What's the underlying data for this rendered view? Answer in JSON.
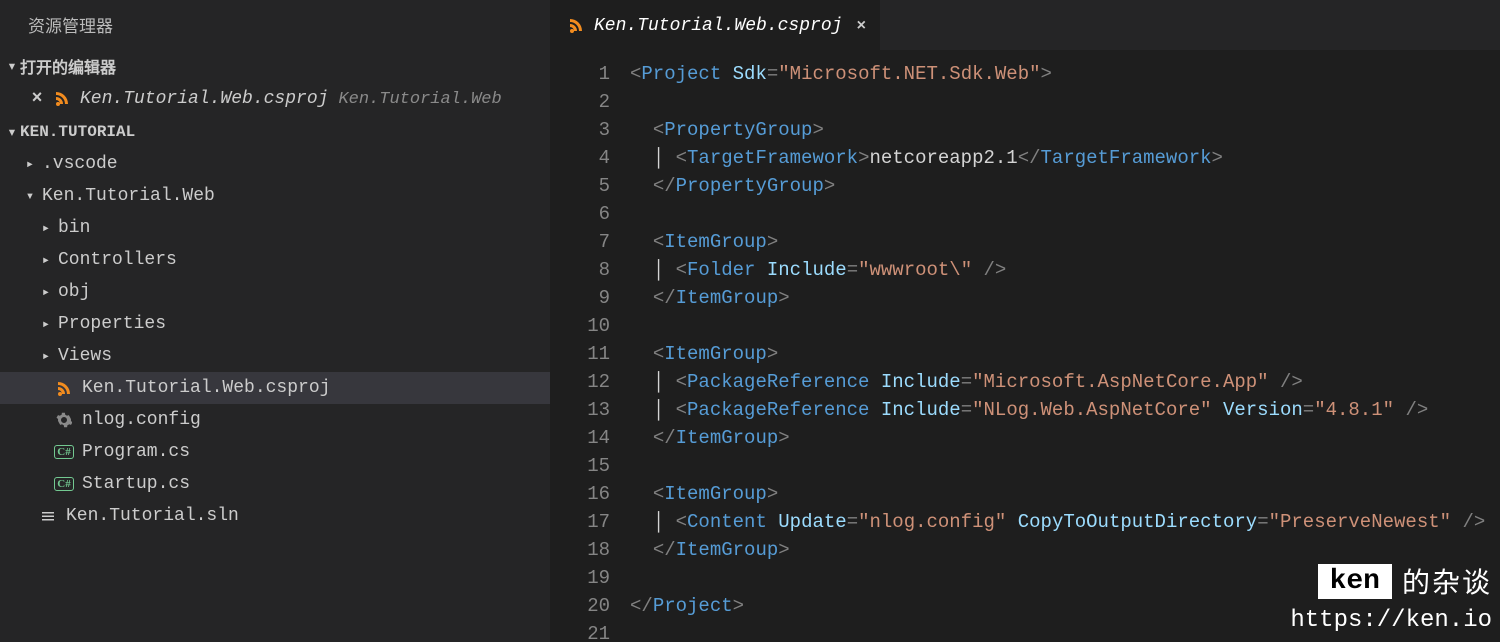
{
  "sidebar": {
    "title": "资源管理器",
    "openEditorsLabel": "打开的编辑器",
    "openEditor": {
      "file": "Ken.Tutorial.Web.csproj",
      "path": "Ken.Tutorial.Web"
    },
    "workspace": "KEN.TUTORIAL",
    "tree": [
      {
        "indent": 1,
        "chev": "▸",
        "icon": "",
        "label": ".vscode"
      },
      {
        "indent": 1,
        "chev": "▾",
        "icon": "",
        "label": "Ken.Tutorial.Web"
      },
      {
        "indent": 2,
        "chev": "▸",
        "icon": "",
        "label": "bin"
      },
      {
        "indent": 2,
        "chev": "▸",
        "icon": "",
        "label": "Controllers"
      },
      {
        "indent": 2,
        "chev": "▸",
        "icon": "",
        "label": "obj"
      },
      {
        "indent": 2,
        "chev": "▸",
        "icon": "",
        "label": "Properties"
      },
      {
        "indent": 2,
        "chev": "▸",
        "icon": "",
        "label": "Views"
      },
      {
        "indent": 2,
        "chev": "",
        "icon": "rss",
        "label": "Ken.Tutorial.Web.csproj",
        "selected": true
      },
      {
        "indent": 2,
        "chev": "",
        "icon": "gear",
        "label": "nlog.config"
      },
      {
        "indent": 2,
        "chev": "",
        "icon": "cs",
        "label": "Program.cs"
      },
      {
        "indent": 2,
        "chev": "",
        "icon": "cs",
        "label": "Startup.cs"
      },
      {
        "indent": 1,
        "chev": "",
        "icon": "file",
        "label": "Ken.Tutorial.sln"
      }
    ]
  },
  "tab": {
    "file": "Ken.Tutorial.Web.csproj"
  },
  "code": [
    [
      {
        "c": "punc",
        "t": "<"
      },
      {
        "c": "tag",
        "t": "Project"
      },
      {
        "c": "text",
        "t": " "
      },
      {
        "c": "attr",
        "t": "Sdk"
      },
      {
        "c": "punc",
        "t": "="
      },
      {
        "c": "str",
        "t": "\"Microsoft.NET.Sdk.Web\""
      },
      {
        "c": "punc",
        "t": ">"
      }
    ],
    [],
    [
      {
        "c": "text",
        "t": "  "
      },
      {
        "c": "punc",
        "t": "<"
      },
      {
        "c": "tag",
        "t": "PropertyGroup"
      },
      {
        "c": "punc",
        "t": ">"
      }
    ],
    [
      {
        "c": "text",
        "t": "  "
      },
      {
        "c": "guide",
        "t": "│ "
      },
      {
        "c": "punc",
        "t": "<"
      },
      {
        "c": "tag",
        "t": "TargetFramework"
      },
      {
        "c": "punc",
        "t": ">"
      },
      {
        "c": "text",
        "t": "netcoreapp2.1"
      },
      {
        "c": "punc",
        "t": "</"
      },
      {
        "c": "tag",
        "t": "TargetFramework"
      },
      {
        "c": "punc",
        "t": ">"
      }
    ],
    [
      {
        "c": "text",
        "t": "  "
      },
      {
        "c": "punc",
        "t": "</"
      },
      {
        "c": "tag",
        "t": "PropertyGroup"
      },
      {
        "c": "punc",
        "t": ">"
      }
    ],
    [],
    [
      {
        "c": "text",
        "t": "  "
      },
      {
        "c": "punc",
        "t": "<"
      },
      {
        "c": "tag",
        "t": "ItemGroup"
      },
      {
        "c": "punc",
        "t": ">"
      }
    ],
    [
      {
        "c": "text",
        "t": "  "
      },
      {
        "c": "guide",
        "t": "│ "
      },
      {
        "c": "punc",
        "t": "<"
      },
      {
        "c": "tag",
        "t": "Folder"
      },
      {
        "c": "text",
        "t": " "
      },
      {
        "c": "attr",
        "t": "Include"
      },
      {
        "c": "punc",
        "t": "="
      },
      {
        "c": "str",
        "t": "\"wwwroot\\\""
      },
      {
        "c": "text",
        "t": " "
      },
      {
        "c": "punc",
        "t": "/>"
      }
    ],
    [
      {
        "c": "text",
        "t": "  "
      },
      {
        "c": "punc",
        "t": "</"
      },
      {
        "c": "tag",
        "t": "ItemGroup"
      },
      {
        "c": "punc",
        "t": ">"
      }
    ],
    [],
    [
      {
        "c": "text",
        "t": "  "
      },
      {
        "c": "punc",
        "t": "<"
      },
      {
        "c": "tag",
        "t": "ItemGroup"
      },
      {
        "c": "punc",
        "t": ">"
      }
    ],
    [
      {
        "c": "text",
        "t": "  "
      },
      {
        "c": "guide",
        "t": "│ "
      },
      {
        "c": "punc",
        "t": "<"
      },
      {
        "c": "tag",
        "t": "PackageReference"
      },
      {
        "c": "text",
        "t": " "
      },
      {
        "c": "attr",
        "t": "Include"
      },
      {
        "c": "punc",
        "t": "="
      },
      {
        "c": "str",
        "t": "\"Microsoft.AspNetCore.App\""
      },
      {
        "c": "text",
        "t": " "
      },
      {
        "c": "punc",
        "t": "/>"
      }
    ],
    [
      {
        "c": "text",
        "t": "  "
      },
      {
        "c": "guide",
        "t": "│ "
      },
      {
        "c": "punc",
        "t": "<"
      },
      {
        "c": "tag",
        "t": "PackageReference"
      },
      {
        "c": "text",
        "t": " "
      },
      {
        "c": "attr",
        "t": "Include"
      },
      {
        "c": "punc",
        "t": "="
      },
      {
        "c": "str",
        "t": "\"NLog.Web.AspNetCore\""
      },
      {
        "c": "text",
        "t": " "
      },
      {
        "c": "attr",
        "t": "Version"
      },
      {
        "c": "punc",
        "t": "="
      },
      {
        "c": "str",
        "t": "\"4.8.1\""
      },
      {
        "c": "text",
        "t": " "
      },
      {
        "c": "punc",
        "t": "/>"
      }
    ],
    [
      {
        "c": "text",
        "t": "  "
      },
      {
        "c": "punc",
        "t": "</"
      },
      {
        "c": "tag",
        "t": "ItemGroup"
      },
      {
        "c": "punc",
        "t": ">"
      }
    ],
    [],
    [
      {
        "c": "text",
        "t": "  "
      },
      {
        "c": "punc",
        "t": "<"
      },
      {
        "c": "tag",
        "t": "ItemGroup"
      },
      {
        "c": "punc",
        "t": ">"
      }
    ],
    [
      {
        "c": "text",
        "t": "  "
      },
      {
        "c": "guide",
        "t": "│ "
      },
      {
        "c": "punc",
        "t": "<"
      },
      {
        "c": "tag",
        "t": "Content"
      },
      {
        "c": "text",
        "t": " "
      },
      {
        "c": "attr",
        "t": "Update"
      },
      {
        "c": "punc",
        "t": "="
      },
      {
        "c": "str",
        "t": "\"nlog.config\""
      },
      {
        "c": "text",
        "t": " "
      },
      {
        "c": "attr",
        "t": "CopyToOutputDirectory"
      },
      {
        "c": "punc",
        "t": "="
      },
      {
        "c": "str",
        "t": "\"PreserveNewest\""
      },
      {
        "c": "text",
        "t": " "
      },
      {
        "c": "punc",
        "t": "/>"
      }
    ],
    [
      {
        "c": "text",
        "t": "  "
      },
      {
        "c": "punc",
        "t": "</"
      },
      {
        "c": "tag",
        "t": "ItemGroup"
      },
      {
        "c": "punc",
        "t": ">"
      }
    ],
    [],
    [
      {
        "c": "punc",
        "t": "</"
      },
      {
        "c": "tag",
        "t": "Project"
      },
      {
        "c": "punc",
        "t": ">"
      }
    ],
    []
  ],
  "watermark": {
    "name": "ken",
    "subtitle": "的杂谈",
    "url": "https://ken.io"
  }
}
